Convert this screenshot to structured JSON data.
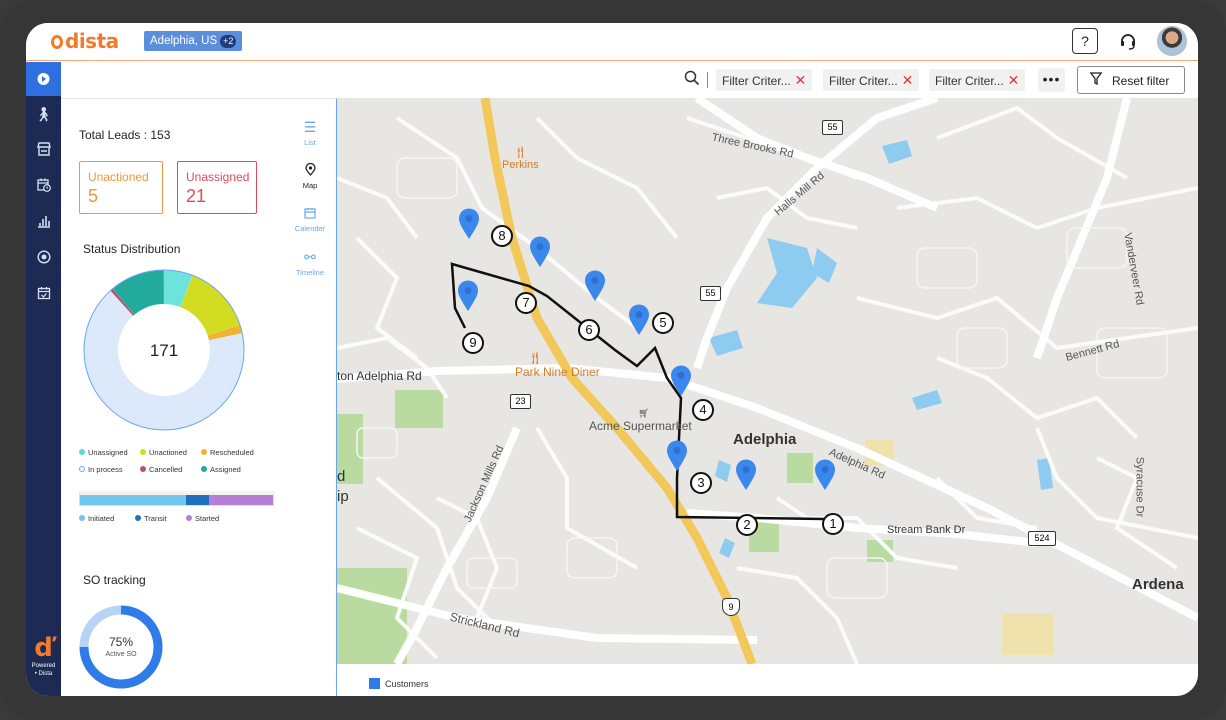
{
  "app": {
    "logo_text": "dista",
    "brand_color": "#ef7b2b",
    "nav_color": "#1d2a53",
    "accent": "#2f6fe0"
  },
  "header": {
    "location": "Adelphia, US",
    "location_badge": "+2",
    "help_icon": "question-box-icon",
    "support_icon": "headset-icon"
  },
  "leftnav": {
    "items": [
      "play-icon",
      "walk-icon",
      "store-icon",
      "calendar-clock-icon",
      "bar-chart-icon",
      "gauge-icon",
      "calendar-check-icon"
    ],
    "powered_line1": "Powered",
    "powered_line2": "• Dista"
  },
  "filters": {
    "chips": [
      "Filter Criter...",
      "Filter Criter...",
      "Filter Criter..."
    ],
    "more": "•••",
    "reset_label": "Reset filter"
  },
  "panel": {
    "total_leads": "Total Leads : 153",
    "cards": [
      {
        "label": "Unactioned",
        "value": "5",
        "color": "#f4943e"
      },
      {
        "label": "Unassigned",
        "value": "21",
        "color": "#e24a5c"
      }
    ],
    "status_title": "Status Distribution",
    "donut_center": "171",
    "status_legend": [
      {
        "label": "Unassigned",
        "color": "#55ddd6"
      },
      {
        "label": "Unactioned",
        "color": "#d4dc1d"
      },
      {
        "label": "Rescheduled",
        "color": "#f2b233"
      },
      {
        "label": "In process",
        "color": "#dbe8fb",
        "hollow": true
      },
      {
        "label": "Cancelled",
        "color": "#b4546c"
      },
      {
        "label": "Assigned",
        "color": "#22aa9c"
      }
    ],
    "status_values": [
      {
        "name": "Unassigned",
        "value": 10,
        "color": "#6ee3dc"
      },
      {
        "name": "Unactioned",
        "value": 24,
        "color": "#d2dd22"
      },
      {
        "name": "Rescheduled",
        "value": 3,
        "color": "#f2b233"
      },
      {
        "name": "In process",
        "value": 114,
        "color": "#dce9fb"
      },
      {
        "name": "Cancelled",
        "value": 1,
        "color": "#b4546c"
      },
      {
        "name": "Assigned",
        "value": 19,
        "color": "#22aa9c"
      }
    ],
    "stage_bar": [
      {
        "name": "Initiated",
        "value": 55,
        "color": "#6fc7ec"
      },
      {
        "name": "Transit",
        "value": 12,
        "color": "#1f6fba"
      },
      {
        "name": "Started",
        "value": 33,
        "color": "#b57fd6"
      }
    ],
    "so_title": "SO tracking",
    "so_percent": "75%",
    "so_sub": "Active SO",
    "so_value": 0.75
  },
  "view_tools": [
    {
      "label": "List",
      "icon": "list-icon"
    },
    {
      "label": "Map",
      "icon": "map-pin-icon"
    },
    {
      "label": "Calender",
      "icon": "calendar-icon"
    },
    {
      "label": "Timeline",
      "icon": "timeline-icon"
    }
  ],
  "map": {
    "labels": {
      "perkins": "Perkins",
      "park_nine": "Park Nine Diner",
      "acme": "Acme Supermarket",
      "adelphia": "Adelphia",
      "ardena": "Ardena",
      "three_brooks": "Three Brooks Rd",
      "halls_mill": "Halls Mill Rd",
      "vanderveer": "Vanderveer Rd",
      "bennett": "Bennett Rd",
      "adelphia_rd_w": "ton Adelphia Rd",
      "adelphia_rd_e": "Adelphia Rd",
      "jackson_mills": "Jackson Mills Rd",
      "stream_bank": "Stream Bank Dr",
      "syracuse": "Syracuse Dr",
      "strickland": "Strickland Rd",
      "edge1": "d",
      "edge2": "ip"
    },
    "shields": {
      "r55a": "55",
      "r55b": "55",
      "r23": "23",
      "r524": "524",
      "r9": "9"
    },
    "stops": [
      "1",
      "2",
      "3",
      "4",
      "5",
      "6",
      "7",
      "8",
      "9"
    ],
    "legend": "Customers"
  }
}
